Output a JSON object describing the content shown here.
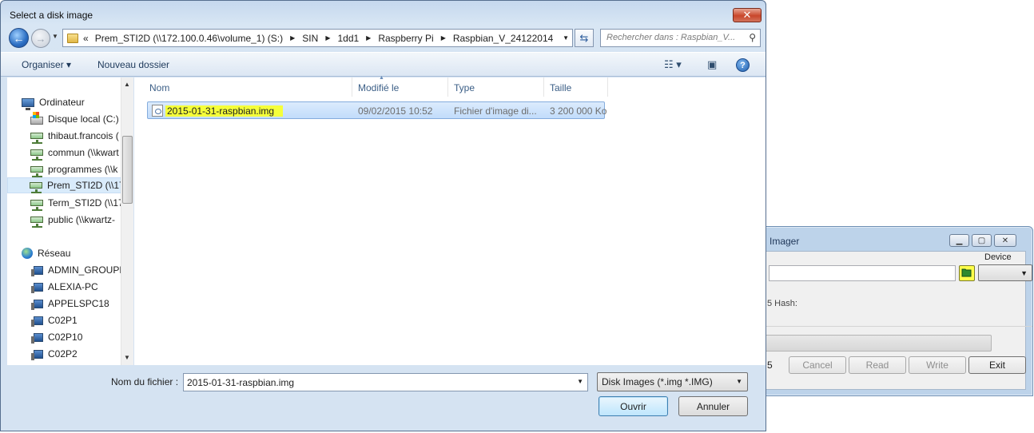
{
  "imager": {
    "title": "Imager",
    "device_label": "Device",
    "hash_label": "5 Hash:",
    "partial_left": "5",
    "buttons": [
      "Cancel",
      "Read",
      "Write",
      "Exit"
    ],
    "highlight_color": "#ffff4a"
  },
  "dialog": {
    "title": "Select a disk image",
    "close_glyph": "✕",
    "address": {
      "lead": "«",
      "crumbs": [
        "Prem_STI2D (\\\\172.100.0.46\\volume_1) (S:)",
        "SIN",
        "1dd1",
        "Raspberry Pi",
        "Raspbian_V_24122014"
      ]
    },
    "search_placeholder": "Rechercher dans : Raspbian_V...",
    "toolbar": {
      "organize": "Organiser ▾",
      "new_folder": "Nouveau dossier",
      "help": "?"
    },
    "nav": {
      "computer": "Ordinateur",
      "drives": [
        "Disque local (C:)",
        "thibaut.francois (",
        "commun (\\\\kwart",
        "programmes (\\\\k",
        "Prem_STI2D (\\\\17",
        "Term_STI2D (\\\\17",
        "public (\\\\kwartz-"
      ],
      "network": "Réseau",
      "hosts": [
        "ADMIN_GROUPE",
        "ALEXIA-PC",
        "APPELSPC18",
        "C02P1",
        "C02P10",
        "C02P2"
      ]
    },
    "columns": [
      "Nom",
      "Modifié le",
      "Type",
      "Taille"
    ],
    "files": [
      {
        "name": "2015-01-31-raspbian.img",
        "modified": "09/02/2015 10:52",
        "type": "Fichier d'image di...",
        "size": "3 200 000 Ko"
      }
    ],
    "filename_label": "Nom du fichier :",
    "filename_value": "2015-01-31-raspbian.img",
    "filter_value": "Disk Images (*.img *.IMG)",
    "open_label": "Ouvrir",
    "cancel_label": "Annuler",
    "highlight_color": "#f5ff3a"
  }
}
